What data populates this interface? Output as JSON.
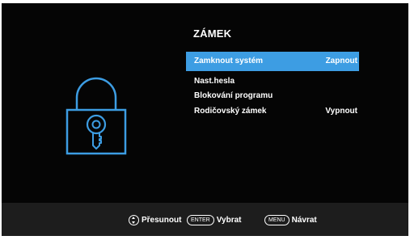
{
  "colors": {
    "screen_bg": "#050505",
    "footer_bg": "#1d1d1d",
    "highlight": "#3d9de3",
    "lock_outline": "#3d9de3"
  },
  "lock_icon": "padlock-with-key-icon",
  "menu": {
    "title": "ZÁMEK",
    "items": [
      {
        "label": "Zamknout systém",
        "value": "Zapnout",
        "selected": true
      },
      {
        "label": "Nast.hesla",
        "value": ""
      },
      {
        "label": "Blokování programu",
        "value": ""
      },
      {
        "label": "Rodičovský zámek",
        "value": "Vypnout"
      }
    ]
  },
  "footer": {
    "move": {
      "icon": "up-down-arrows-icon",
      "label": "Přesunout"
    },
    "enter": {
      "key": "ENTER",
      "label": "Vybrat"
    },
    "menu": {
      "key": "MENU",
      "label": "Návrat"
    }
  }
}
